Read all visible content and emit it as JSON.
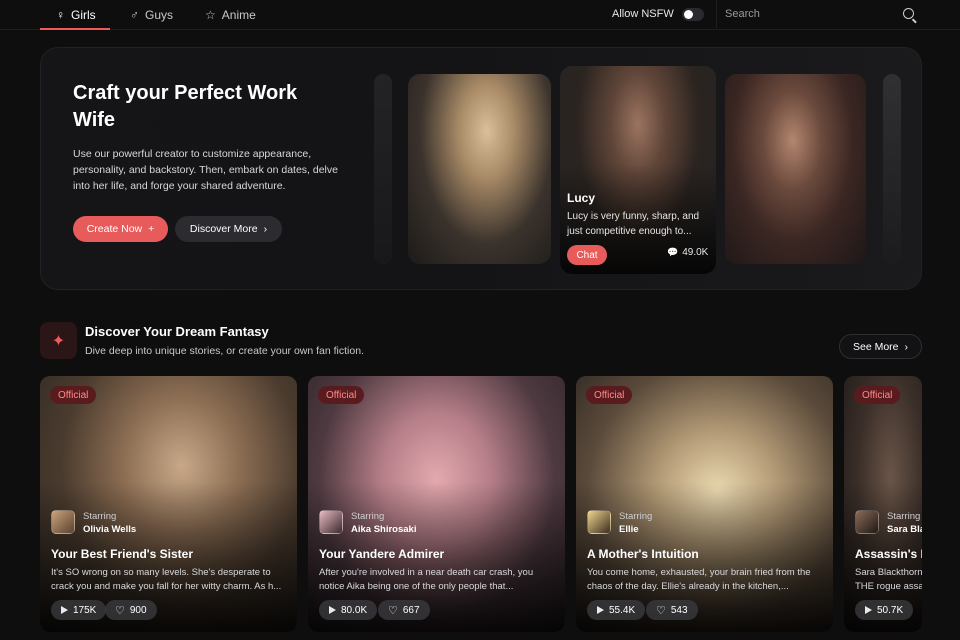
{
  "nav": {
    "tabs": [
      {
        "label": "Girls",
        "icon": "female-icon"
      },
      {
        "label": "Guys",
        "icon": "male-icon"
      },
      {
        "label": "Anime",
        "icon": "star-icon"
      }
    ],
    "nsfw_label": "Allow NSFW",
    "search_placeholder": "Search"
  },
  "hero": {
    "title": "Craft your Perfect Work Wife",
    "description": "Use our powerful creator to customize appearance, personality, and backstory. Then, embark on dates, delve into her life, and forge your shared adventure.",
    "create_label": "Create Now",
    "discover_label": "Discover More",
    "featured": {
      "name": "Lucy",
      "description": "Lucy is very funny, sharp, and just competitive enough to...",
      "chat_label": "Chat",
      "count": "49.0K"
    }
  },
  "section": {
    "title": "Discover Your Dream Fantasy",
    "subtitle": "Dive deep into unique stories, or create your own fan fiction.",
    "see_more_label": "See More"
  },
  "cards": [
    {
      "badge": "Official",
      "starring": "Starring",
      "actor": "Olivia Wells",
      "title": "Your Best Friend's Sister",
      "description": "It's SO wrong on so many levels. She's desperate to crack you and make you fall for her witty charm. As h...",
      "plays": "175K",
      "likes": "900"
    },
    {
      "badge": "Official",
      "starring": "Starring",
      "actor": "Aika Shirosaki",
      "title": "Your Yandere Admirer",
      "description": "After you're involved in a near death car crash, you notice Aika being one of the only people that...",
      "plays": "80.0K",
      "likes": "667"
    },
    {
      "badge": "Official",
      "starring": "Starring",
      "actor": "Ellie",
      "title": "A Mother's Intuition",
      "description": "You come home, exhausted, your brain fried from the chaos of the day. Ellie's already in the kitchen,...",
      "plays": "55.4K",
      "likes": "543"
    },
    {
      "badge": "Official",
      "starring": "Starring",
      "actor": "Sara Bla",
      "title": "Assassin's N",
      "description": "Sara Blackthorn THE rogue assa",
      "plays": "50.7K",
      "likes": ""
    }
  ]
}
